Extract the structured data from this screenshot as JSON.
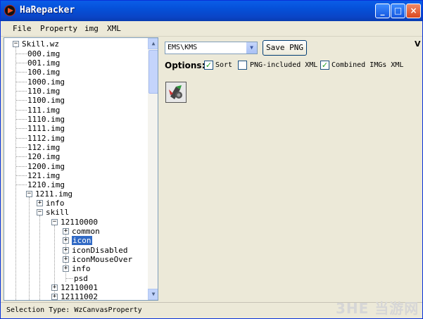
{
  "window": {
    "title": "HaRepacker"
  },
  "menu": [
    "File",
    "Property",
    "img",
    "XML"
  ],
  "tree": {
    "root": "Skill.wz",
    "items": [
      "000.img",
      "001.img",
      "100.img",
      "1000.img",
      "110.img",
      "1100.img",
      "111.img",
      "1110.img",
      "1111.img",
      "1112.img",
      "112.img",
      "120.img",
      "1200.img",
      "121.img",
      "1210.img"
    ],
    "expanded_img": "1211.img",
    "info": "info",
    "skill": "skill",
    "skill_id": "12110000",
    "children": [
      "common",
      "icon",
      "iconDisabled",
      "iconMouseOver",
      "info",
      "psd"
    ],
    "selected": "icon",
    "more_skills": [
      "12110001",
      "12111002"
    ]
  },
  "toolbar": {
    "version_value": "EMS\\KMS",
    "save_png": "Save PNG",
    "corner_text": "V"
  },
  "options": {
    "label": "Options:",
    "sort": {
      "label": "Sort",
      "checked": true
    },
    "png_xml": {
      "label": "PNG-included XML",
      "checked": false
    },
    "combined_xml": {
      "label": "Combined IMGs XML",
      "checked": true
    }
  },
  "status": {
    "text": "Selection Type: WzCanvasProperty"
  },
  "watermark": "3HE 当游网",
  "colors": {
    "title_bar": "#0a5de8",
    "selection": "#316ac5",
    "check": "#21a121"
  }
}
